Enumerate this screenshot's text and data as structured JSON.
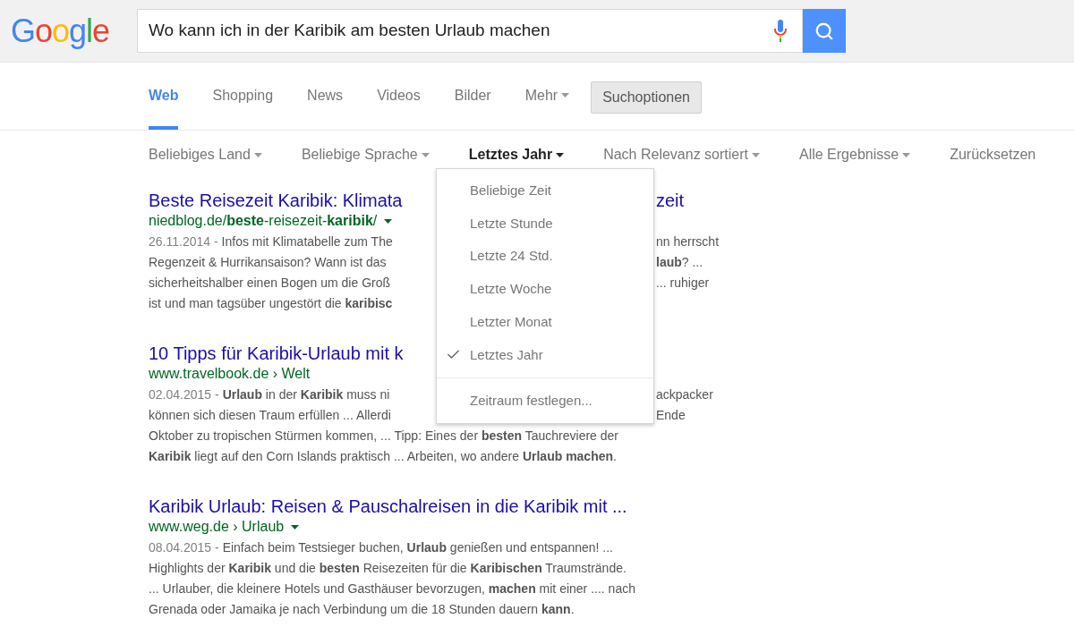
{
  "header": {
    "logo": "Google",
    "query": "Wo kann ich in der Karibik am besten Urlaub machen"
  },
  "tabs": [
    {
      "label": "Web",
      "selected": true,
      "menu": false
    },
    {
      "label": "Shopping",
      "selected": false,
      "menu": false
    },
    {
      "label": "News",
      "selected": false,
      "menu": false
    },
    {
      "label": "Videos",
      "selected": false,
      "menu": false
    },
    {
      "label": "Bilder",
      "selected": false,
      "menu": false
    },
    {
      "label": "Mehr",
      "selected": false,
      "menu": true
    }
  ],
  "tools_button": {
    "label": "Suchoptionen",
    "on": true
  },
  "filters": [
    {
      "label": "Beliebiges Land",
      "active": false,
      "menu": true
    },
    {
      "label": "Beliebige Sprache",
      "active": false,
      "menu": true
    },
    {
      "label": "Letztes Jahr",
      "active": true,
      "menu": true
    },
    {
      "label": "Nach Relevanz sortiert",
      "active": false,
      "menu": true
    },
    {
      "label": "Alle Ergebnisse",
      "active": false,
      "menu": true
    },
    {
      "label": "Zurücksetzen",
      "active": false,
      "menu": false
    }
  ],
  "dropdown": {
    "items": [
      {
        "kind": "option",
        "label": "Beliebige Zeit",
        "selected": false
      },
      {
        "kind": "option",
        "label": "Letzte Stunde",
        "selected": false
      },
      {
        "kind": "option",
        "label": "Letzte 24 Std.",
        "selected": false
      },
      {
        "kind": "option",
        "label": "Letzte Woche",
        "selected": false
      },
      {
        "kind": "option",
        "label": "Letzter Monat",
        "selected": false
      },
      {
        "kind": "option",
        "label": "Letztes Jahr",
        "selected": true
      },
      {
        "kind": "separator"
      },
      {
        "kind": "option",
        "label": "Zeitraum festlegen...",
        "selected": false
      }
    ]
  },
  "results": [
    {
      "title": [
        "Beste Reisezeit Karibik: Klimata",
        "zeit"
      ],
      "url": "niedblog.de/**beste**-reisezeit-**karibik**/",
      "url_menu": true,
      "date": "26.11.2014 -",
      "lines": [
        [
          "Infos mit Klimatabelle zum The",
          "nn herrscht"
        ],
        [
          "Regenzeit & Hurrikansaison? Wann ist das",
          "**laub**? ..."
        ],
        [
          "sicherheitshalber einen Bogen um die Groß",
          "... ruhiger"
        ],
        [
          "ist und man tagsüber ungestört die **karibisc**"
        ]
      ]
    },
    {
      "title": [
        "10 Tipps für Karibik-Urlaub mit k"
      ],
      "url": "www.travelbook.de › Welt",
      "url_menu": false,
      "date": "02.04.2015 -",
      "lines": [
        [
          "**Urlaub** in der **Karibik** muss ni",
          "ackpacker"
        ],
        [
          "können sich diesen Traum erfüllen ... Allerdi",
          "Ende"
        ],
        [
          "Oktober zu tropischen Stürmen kommen, ... Tipp: Eines der **besten** Tauchreviere der"
        ],
        [
          "**Karibik** liegt auf den Corn Islands praktisch ... Arbeiten, wo andere **Urlaub machen**."
        ]
      ]
    },
    {
      "title": [
        "Karibik Urlaub: Reisen & Pauschalreisen in die Karibik mit ..."
      ],
      "url": "www.weg.de › Urlaub",
      "url_menu": true,
      "date": "08.04.2015 -",
      "lines": [
        [
          "Einfach beim Testsieger buchen, **Urlaub** genießen und entspannen! ..."
        ],
        [
          "Highlights der **Karibik** und die **besten** Reisezeiten für die **Karibischen** Traumstrände."
        ],
        [
          "... Urlauber, die kleinere Hotels und Gasthäuser bevorzugen, **machen** mit einer .... nach"
        ],
        [
          "Grenada oder Jamaika je nach Verbindung um die 18 Stunden dauern **kann**."
        ]
      ]
    }
  ]
}
